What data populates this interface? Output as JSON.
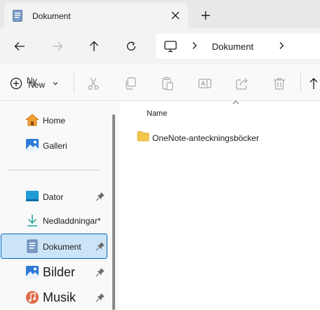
{
  "tab": {
    "title": "Dokument",
    "icon": "documents-folder-icon",
    "close_icon": "close-icon",
    "new_tab_icon": "plus-icon"
  },
  "navigation": {
    "back_icon": "arrow-left-icon",
    "forward_icon": "arrow-right-icon",
    "up_icon": "arrow-up-icon",
    "refresh_icon": "refresh-icon"
  },
  "address": {
    "segments": [
      "Dokument"
    ]
  },
  "commandbar": {
    "new_label_sv": "Ny",
    "new_label_en": "New",
    "buttons": [
      "cut",
      "copy",
      "paste",
      "rename",
      "share",
      "delete",
      "sort"
    ]
  },
  "sidebar": {
    "items": [
      {
        "label": "Home",
        "icon": "home-icon"
      },
      {
        "label": "Galleri",
        "icon": "gallery-icon"
      },
      {
        "label": "Dator",
        "icon": "desktop-icon",
        "pinned": true
      },
      {
        "label": "Nedladdningar*",
        "icon": "downloads-icon"
      },
      {
        "label": "Dokument",
        "icon": "documents-icon",
        "pinned": true,
        "selected": true
      },
      {
        "label": "Bilder",
        "icon": "pictures-icon",
        "pinned": true
      },
      {
        "label": "Musik",
        "icon": "music-icon",
        "pinned": true
      }
    ]
  },
  "content": {
    "column_header": "Name",
    "files": [
      {
        "name": "OneNote-anteckningsböcker",
        "type": "folder"
      }
    ]
  },
  "colors": {
    "accent": "#0067c0",
    "selected_bg": "#cce4f7",
    "folder": "#f4c84e"
  }
}
